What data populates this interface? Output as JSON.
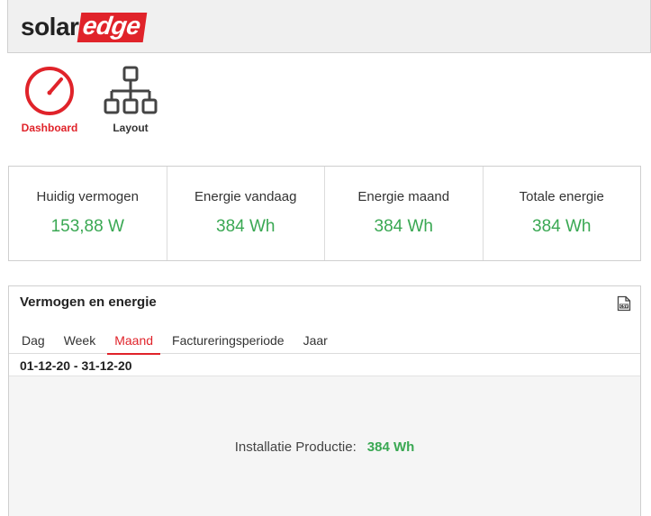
{
  "header": {
    "logo_solar": "solar",
    "logo_edge": "edge"
  },
  "nav": {
    "items": [
      {
        "label": "Dashboard",
        "icon": "speedometer-icon",
        "active": true
      },
      {
        "label": "Layout",
        "icon": "site-layout-icon",
        "active": false
      }
    ]
  },
  "kpis": [
    {
      "label": "Huidig vermogen",
      "value": "153,88 W"
    },
    {
      "label": "Energie vandaag",
      "value": "384 Wh"
    },
    {
      "label": "Energie maand",
      "value": "384 Wh"
    },
    {
      "label": "Totale energie",
      "value": "384 Wh"
    }
  ],
  "panel": {
    "title": "Vermogen en energie",
    "export_icon": "csv-export-icon",
    "tabs": [
      {
        "label": "Dag",
        "active": false
      },
      {
        "label": "Week",
        "active": false
      },
      {
        "label": "Maand",
        "active": true
      },
      {
        "label": "Factureringsperiode",
        "active": false
      },
      {
        "label": "Jaar",
        "active": false
      }
    ],
    "date_range": "01-12-20 - 31-12-20",
    "production_label": "Installatie Productie:",
    "production_value": "384 Wh"
  },
  "colors": {
    "brand_red": "#e0232a",
    "value_green": "#3aa853"
  }
}
